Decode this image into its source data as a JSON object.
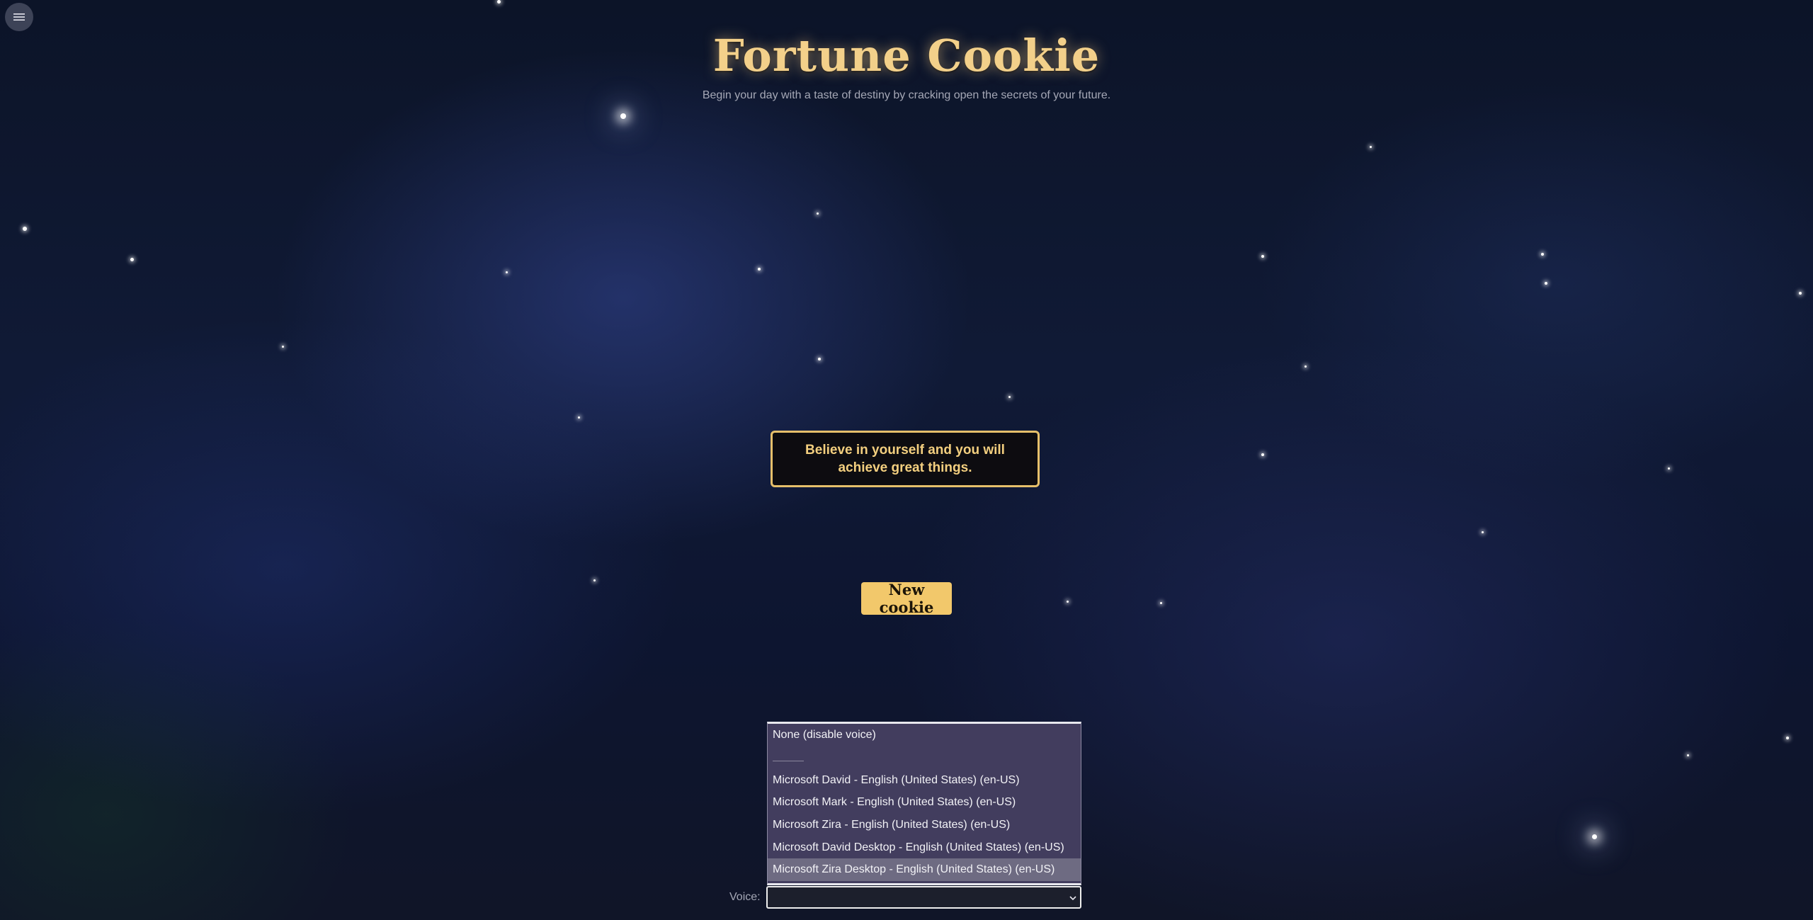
{
  "header": {
    "menu_icon": "hamburger-menu-icon",
    "title": "Fortune Cookie",
    "subtitle": "Begin your day with a taste of destiny by cracking open the secrets of your future."
  },
  "fortune": {
    "text": "Believe in yourself and you will achieve great things."
  },
  "actions": {
    "new_cookie_label": "New cookie"
  },
  "voice": {
    "label": "Voice:",
    "selected_value": "",
    "options": [
      "None (disable voice)",
      "Microsoft David - English (United States) (en-US)",
      "Microsoft Mark - English (United States) (en-US)",
      "Microsoft Zira - English (United States) (en-US)",
      "Microsoft David Desktop - English (United States) (en-US)",
      "Microsoft Zira Desktop - English (United States) (en-US)"
    ],
    "highlighted_option": "Microsoft Zira Desktop - English (United States) (en-US)"
  },
  "colors": {
    "accent": "#f2c86b",
    "title": "#f3d08a",
    "dropdown_bg": "#423d5e",
    "dropdown_highlight": "#6e6b82"
  }
}
